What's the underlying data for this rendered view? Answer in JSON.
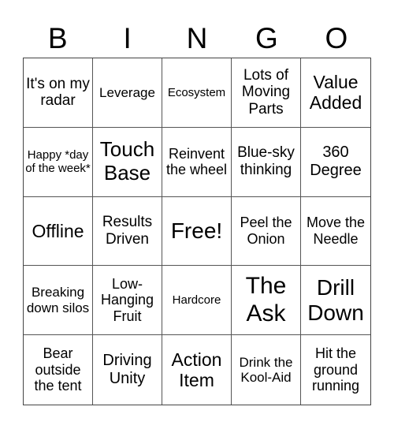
{
  "header": [
    "B",
    "I",
    "N",
    "G",
    "O"
  ],
  "cells": [
    "It's on my radar",
    "Leverage",
    "Ecosystem",
    "Lots of Moving Parts",
    "Value Added",
    "Happy *day of the week*",
    "Touch Base",
    "Reinvent the wheel",
    "Blue-sky thinking",
    "360 Degree",
    "Offline",
    "Results Driven",
    "Free!",
    "Peel the Onion",
    "Move the Needle",
    "Breaking down silos",
    "Low-Hanging Fruit",
    "Hardcore",
    "The Ask",
    "Drill Down",
    "Bear outside the tent",
    "Driving Unity",
    "Action Item",
    "Drink the Kool-Aid",
    "Hit the ground running"
  ]
}
